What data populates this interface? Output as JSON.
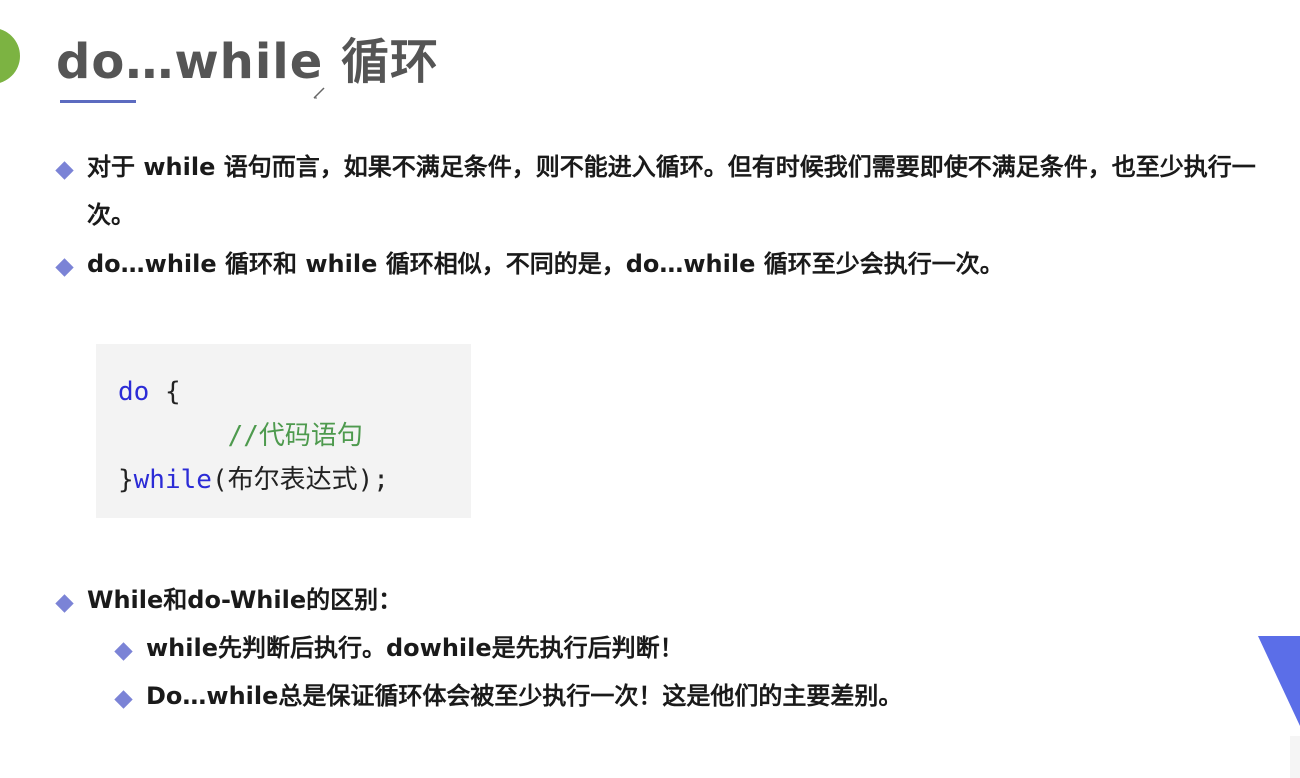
{
  "title": "do…while 循环",
  "bullets": [
    "对于 while 语句而言，如果不满足条件，则不能进入循环。但有时候我们需要即使不满足条件，也至少执行一次。",
    "do…while 循环和 while 循环相似，不同的是，do…while 循环至少会执行一次。"
  ],
  "code": {
    "line1_kw": "do",
    "line1_rest": " {",
    "line2_indent": "       ",
    "line2_comment": "//代码语句",
    "line3_start": "}",
    "line3_kw": "while",
    "line3_rest": "(布尔表达式);"
  },
  "difference": {
    "heading": "While和do-While的区别：",
    "items": [
      "while先判断后执行。dowhile是先执行后判断！",
      "Do…while总是保证循环体会被至少执行一次！这是他们的主要差别。"
    ]
  },
  "colors": {
    "accent_bullet": "#7b83d6",
    "title_underline": "#5c6bc0",
    "keyword": "#2b2bd6",
    "comment": "#4e9a4e",
    "circle": "#7cb342"
  }
}
